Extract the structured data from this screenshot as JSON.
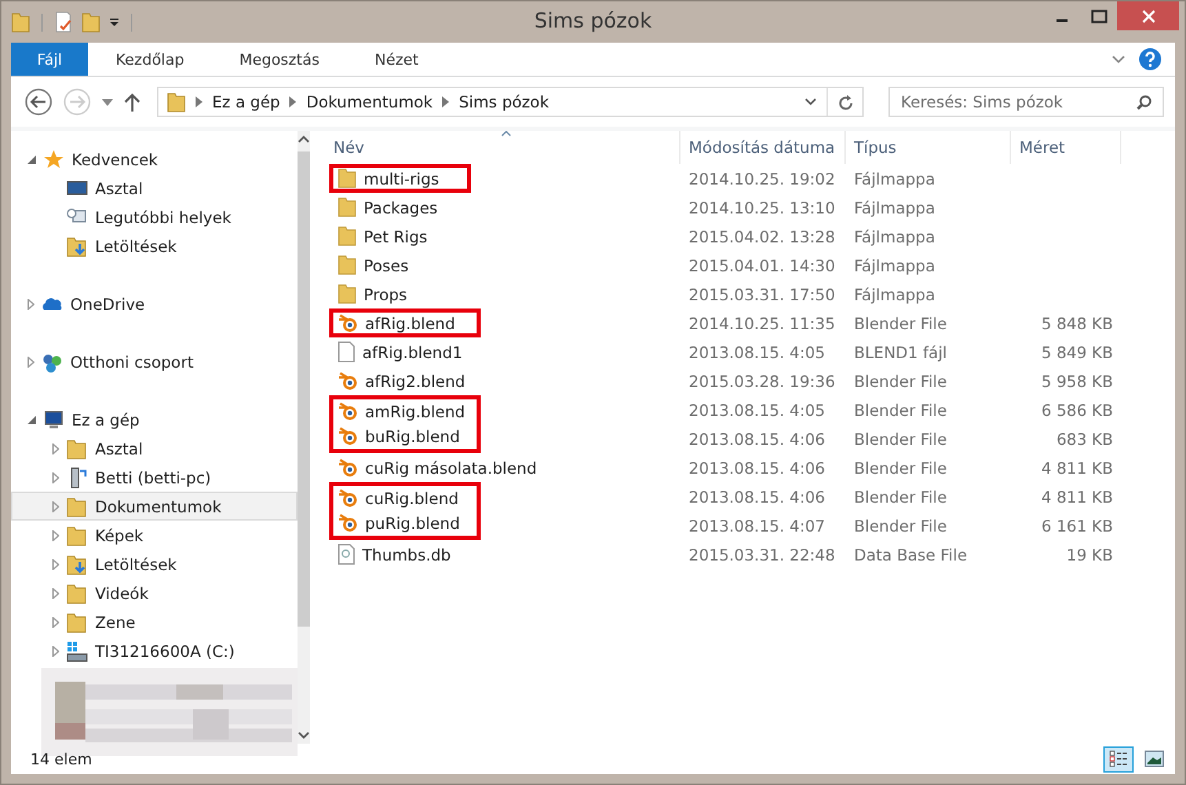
{
  "window": {
    "title": "Sims pózok"
  },
  "ribbon_tabs": [
    {
      "label": "Fájl",
      "kind": "file"
    },
    {
      "label": "Kezdőlap",
      "kind": "tab"
    },
    {
      "label": "Megosztás",
      "kind": "tab"
    },
    {
      "label": "Nézet",
      "kind": "tab"
    }
  ],
  "address": {
    "breadcrumbs": [
      "Ez a gép",
      "Dokumentumok",
      "Sims pózok"
    ]
  },
  "search": {
    "placeholder": "Keresés: Sims pózok"
  },
  "sidebar": {
    "items": [
      {
        "label": "Kedvencek",
        "kind": "star",
        "expanded": true,
        "selected": false,
        "children": [
          {
            "label": "Asztal",
            "kind": "desktop",
            "selected": false
          },
          {
            "label": "Legutóbbi helyek",
            "kind": "recent",
            "selected": false
          },
          {
            "label": "Letöltések",
            "kind": "downloads",
            "selected": false
          }
        ]
      },
      {
        "label": "OneDrive",
        "kind": "cloud",
        "expanded": false,
        "selected": false
      },
      {
        "label": "Otthoni csoport",
        "kind": "homegroup",
        "expanded": false,
        "selected": false
      },
      {
        "label": "Ez a gép",
        "kind": "computer",
        "expanded": true,
        "selected": false,
        "children": [
          {
            "label": "Asztal",
            "kind": "folder",
            "expanded": false,
            "selected": false
          },
          {
            "label": "Betti (betti-pc)",
            "kind": "device",
            "expanded": false,
            "selected": false
          },
          {
            "label": "Dokumentumok",
            "kind": "folder",
            "expanded": false,
            "selected": true
          },
          {
            "label": "Képek",
            "kind": "folder",
            "expanded": false,
            "selected": false
          },
          {
            "label": "Letöltések",
            "kind": "downloads",
            "expanded": false,
            "selected": false
          },
          {
            "label": "Videók",
            "kind": "folder",
            "expanded": false,
            "selected": false
          },
          {
            "label": "Zene",
            "kind": "folder",
            "expanded": false,
            "selected": false
          },
          {
            "label": "TI31216600A (C:)",
            "kind": "drive",
            "expanded": false,
            "selected": false
          }
        ]
      }
    ]
  },
  "table": {
    "columns": [
      "Név",
      "Módosítás dátuma",
      "Típus",
      "Méret"
    ],
    "rows": [
      {
        "name": "multi-rigs",
        "date": "2014.10.25. 19:02",
        "type": "Fájlmappa",
        "kind": "folder",
        "marked": true
      },
      {
        "name": "Packages",
        "date": "2014.10.25. 13:10",
        "type": "Fájlmappa",
        "kind": "folder",
        "marked": false
      },
      {
        "name": "Pet Rigs",
        "date": "2015.04.02. 13:28",
        "type": "Fájlmappa",
        "kind": "folder",
        "marked": false
      },
      {
        "name": "Poses",
        "date": "2015.04.01. 14:30",
        "type": "Fájlmappa",
        "kind": "folder",
        "marked": false
      },
      {
        "name": "Props",
        "date": "2015.03.31. 17:50",
        "type": "Fájlmappa",
        "kind": "folder",
        "marked": false
      },
      {
        "name": "afRig.blend",
        "date": "2014.10.25. 11:35",
        "type": "Blender File",
        "size": "5 848 KB",
        "kind": "blend",
        "marked": true
      },
      {
        "name": "afRig.blend1",
        "date": "2013.08.15. 4:05",
        "type": "BLEND1 fájl",
        "size": "5 849 KB",
        "kind": "file",
        "marked": false
      },
      {
        "name": "afRig2.blend",
        "date": "2015.03.28. 19:36",
        "type": "Blender File",
        "size": "5 958 KB",
        "kind": "blend",
        "marked": false
      },
      {
        "name": "amRig.blend",
        "date": "2013.08.15. 4:05",
        "type": "Blender File",
        "size": "6 586 KB",
        "kind": "blend",
        "marked": true
      },
      {
        "name": "buRig.blend",
        "date": "2013.08.15. 4:06",
        "type": "Blender File",
        "size": "683 KB",
        "kind": "blend",
        "marked": true
      },
      {
        "name": "cuRig másolata.blend",
        "date": "2013.08.15. 4:06",
        "type": "Blender File",
        "size": "4 811 KB",
        "kind": "blend",
        "marked": false
      },
      {
        "name": "cuRig.blend",
        "date": "2013.08.15. 4:06",
        "type": "Blender File",
        "size": "4 811 KB",
        "kind": "blend",
        "marked": true
      },
      {
        "name": "puRig.blend",
        "date": "2013.08.15. 4:07",
        "type": "Blender File",
        "size": "6 161 KB",
        "kind": "blend",
        "marked": true
      },
      {
        "name": "Thumbs.db",
        "date": "2015.03.31. 22:48",
        "type": "Data Base File",
        "size": "19 KB",
        "kind": "db",
        "marked": false
      }
    ]
  },
  "status_bar": {
    "count": "14 elem"
  }
}
